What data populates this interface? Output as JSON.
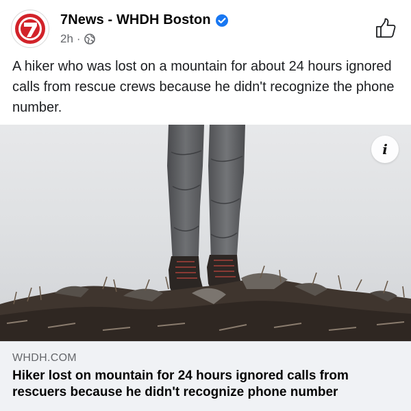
{
  "header": {
    "page_name": "7News - WHDH Boston",
    "time": "2h",
    "separator": "·",
    "avatar_logo_text": "7",
    "brand_red": "#d2232a",
    "verified_color": "#1877f2",
    "icons": {
      "verified": "verified-badge-icon",
      "audience": "globe-icon",
      "like": "thumbs-up-icon"
    }
  },
  "post": {
    "caption": "A hiker who was lost on a mountain for about 24 hours ignored calls from rescue crews because he didn't recognize the phone number."
  },
  "media": {
    "info_glyph": "i",
    "icon": "info-icon"
  },
  "link_preview": {
    "domain": "WHDH.COM",
    "headline": "Hiker lost on mountain for 24 hours ignored calls from rescuers because he didn't recognize phone number"
  }
}
